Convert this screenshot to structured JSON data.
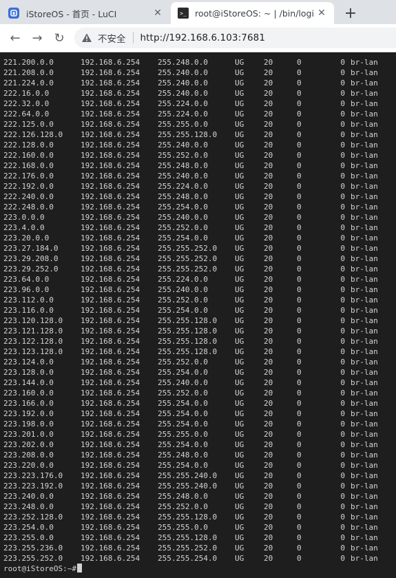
{
  "colors": {
    "tabbar_bg": "#dee1e6",
    "terminal_bg": "#1e1e1e",
    "terminal_fg": "#d4d4d4",
    "warning_icon": "#5f6368"
  },
  "tabs": [
    {
      "title": "iStoreOS - 首页 - LuCI",
      "icon": "istoreos-favicon-icon",
      "close": "✕",
      "active": false
    },
    {
      "title": "root@iStoreOS: ~ | /bin/login",
      "icon": "terminal-favicon-icon",
      "close": "✕",
      "active": true
    }
  ],
  "new_tab_label": "+",
  "toolbar": {
    "back_icon": "←",
    "forward_icon": "→",
    "reload_icon": "↻",
    "security_label": "不安全",
    "url": "http://192.168.6.103:7681"
  },
  "terminal": {
    "rows": [
      [
        "221.200.0.0",
        "192.168.6.254",
        "255.248.0.0",
        "UG",
        "20",
        "0",
        "0",
        "br-lan"
      ],
      [
        "221.208.0.0",
        "192.168.6.254",
        "255.240.0.0",
        "UG",
        "20",
        "0",
        "0",
        "br-lan"
      ],
      [
        "221.224.0.0",
        "192.168.6.254",
        "255.240.0.0",
        "UG",
        "20",
        "0",
        "0",
        "br-lan"
      ],
      [
        "222.16.0.0",
        "192.168.6.254",
        "255.240.0.0",
        "UG",
        "20",
        "0",
        "0",
        "br-lan"
      ],
      [
        "222.32.0.0",
        "192.168.6.254",
        "255.224.0.0",
        "UG",
        "20",
        "0",
        "0",
        "br-lan"
      ],
      [
        "222.64.0.0",
        "192.168.6.254",
        "255.224.0.0",
        "UG",
        "20",
        "0",
        "0",
        "br-lan"
      ],
      [
        "222.125.0.0",
        "192.168.6.254",
        "255.255.0.0",
        "UG",
        "20",
        "0",
        "0",
        "br-lan"
      ],
      [
        "222.126.128.0",
        "192.168.6.254",
        "255.255.128.0",
        "UG",
        "20",
        "0",
        "0",
        "br-lan"
      ],
      [
        "222.128.0.0",
        "192.168.6.254",
        "255.240.0.0",
        "UG",
        "20",
        "0",
        "0",
        "br-lan"
      ],
      [
        "222.160.0.0",
        "192.168.6.254",
        "255.252.0.0",
        "UG",
        "20",
        "0",
        "0",
        "br-lan"
      ],
      [
        "222.168.0.0",
        "192.168.6.254",
        "255.248.0.0",
        "UG",
        "20",
        "0",
        "0",
        "br-lan"
      ],
      [
        "222.176.0.0",
        "192.168.6.254",
        "255.240.0.0",
        "UG",
        "20",
        "0",
        "0",
        "br-lan"
      ],
      [
        "222.192.0.0",
        "192.168.6.254",
        "255.224.0.0",
        "UG",
        "20",
        "0",
        "0",
        "br-lan"
      ],
      [
        "222.240.0.0",
        "192.168.6.254",
        "255.248.0.0",
        "UG",
        "20",
        "0",
        "0",
        "br-lan"
      ],
      [
        "222.248.0.0",
        "192.168.6.254",
        "255.254.0.0",
        "UG",
        "20",
        "0",
        "0",
        "br-lan"
      ],
      [
        "223.0.0.0",
        "192.168.6.254",
        "255.240.0.0",
        "UG",
        "20",
        "0",
        "0",
        "br-lan"
      ],
      [
        "223.4.0.0",
        "192.168.6.254",
        "255.252.0.0",
        "UG",
        "20",
        "0",
        "0",
        "br-lan"
      ],
      [
        "223.20.0.0",
        "192.168.6.254",
        "255.254.0.0",
        "UG",
        "20",
        "0",
        "0",
        "br-lan"
      ],
      [
        "223.27.184.0",
        "192.168.6.254",
        "255.255.252.0",
        "UG",
        "20",
        "0",
        "0",
        "br-lan"
      ],
      [
        "223.29.208.0",
        "192.168.6.254",
        "255.255.252.0",
        "UG",
        "20",
        "0",
        "0",
        "br-lan"
      ],
      [
        "223.29.252.0",
        "192.168.6.254",
        "255.255.252.0",
        "UG",
        "20",
        "0",
        "0",
        "br-lan"
      ],
      [
        "223.64.0.0",
        "192.168.6.254",
        "255.224.0.0",
        "UG",
        "20",
        "0",
        "0",
        "br-lan"
      ],
      [
        "223.96.0.0",
        "192.168.6.254",
        "255.240.0.0",
        "UG",
        "20",
        "0",
        "0",
        "br-lan"
      ],
      [
        "223.112.0.0",
        "192.168.6.254",
        "255.252.0.0",
        "UG",
        "20",
        "0",
        "0",
        "br-lan"
      ],
      [
        "223.116.0.0",
        "192.168.6.254",
        "255.254.0.0",
        "UG",
        "20",
        "0",
        "0",
        "br-lan"
      ],
      [
        "223.120.128.0",
        "192.168.6.254",
        "255.255.128.0",
        "UG",
        "20",
        "0",
        "0",
        "br-lan"
      ],
      [
        "223.121.128.0",
        "192.168.6.254",
        "255.255.128.0",
        "UG",
        "20",
        "0",
        "0",
        "br-lan"
      ],
      [
        "223.122.128.0",
        "192.168.6.254",
        "255.255.128.0",
        "UG",
        "20",
        "0",
        "0",
        "br-lan"
      ],
      [
        "223.123.128.0",
        "192.168.6.254",
        "255.255.128.0",
        "UG",
        "20",
        "0",
        "0",
        "br-lan"
      ],
      [
        "223.124.0.0",
        "192.168.6.254",
        "255.252.0.0",
        "UG",
        "20",
        "0",
        "0",
        "br-lan"
      ],
      [
        "223.128.0.0",
        "192.168.6.254",
        "255.254.0.0",
        "UG",
        "20",
        "0",
        "0",
        "br-lan"
      ],
      [
        "223.144.0.0",
        "192.168.6.254",
        "255.240.0.0",
        "UG",
        "20",
        "0",
        "0",
        "br-lan"
      ],
      [
        "223.160.0.0",
        "192.168.6.254",
        "255.252.0.0",
        "UG",
        "20",
        "0",
        "0",
        "br-lan"
      ],
      [
        "223.166.0.0",
        "192.168.6.254",
        "255.254.0.0",
        "UG",
        "20",
        "0",
        "0",
        "br-lan"
      ],
      [
        "223.192.0.0",
        "192.168.6.254",
        "255.254.0.0",
        "UG",
        "20",
        "0",
        "0",
        "br-lan"
      ],
      [
        "223.198.0.0",
        "192.168.6.254",
        "255.254.0.0",
        "UG",
        "20",
        "0",
        "0",
        "br-lan"
      ],
      [
        "223.201.0.0",
        "192.168.6.254",
        "255.255.0.0",
        "UG",
        "20",
        "0",
        "0",
        "br-lan"
      ],
      [
        "223.202.0.0",
        "192.168.6.254",
        "255.254.0.0",
        "UG",
        "20",
        "0",
        "0",
        "br-lan"
      ],
      [
        "223.208.0.0",
        "192.168.6.254",
        "255.248.0.0",
        "UG",
        "20",
        "0",
        "0",
        "br-lan"
      ],
      [
        "223.220.0.0",
        "192.168.6.254",
        "255.254.0.0",
        "UG",
        "20",
        "0",
        "0",
        "br-lan"
      ],
      [
        "223.223.176.0",
        "192.168.6.254",
        "255.255.240.0",
        "UG",
        "20",
        "0",
        "0",
        "br-lan"
      ],
      [
        "223.223.192.0",
        "192.168.6.254",
        "255.255.240.0",
        "UG",
        "20",
        "0",
        "0",
        "br-lan"
      ],
      [
        "223.240.0.0",
        "192.168.6.254",
        "255.248.0.0",
        "UG",
        "20",
        "0",
        "0",
        "br-lan"
      ],
      [
        "223.248.0.0",
        "192.168.6.254",
        "255.252.0.0",
        "UG",
        "20",
        "0",
        "0",
        "br-lan"
      ],
      [
        "223.252.128.0",
        "192.168.6.254",
        "255.255.128.0",
        "UG",
        "20",
        "0",
        "0",
        "br-lan"
      ],
      [
        "223.254.0.0",
        "192.168.6.254",
        "255.255.0.0",
        "UG",
        "20",
        "0",
        "0",
        "br-lan"
      ],
      [
        "223.255.0.0",
        "192.168.6.254",
        "255.255.128.0",
        "UG",
        "20",
        "0",
        "0",
        "br-lan"
      ],
      [
        "223.255.236.0",
        "192.168.6.254",
        "255.255.252.0",
        "UG",
        "20",
        "0",
        "0",
        "br-lan"
      ],
      [
        "223.255.252.0",
        "192.168.6.254",
        "255.255.254.0",
        "UG",
        "20",
        "0",
        "0",
        "br-lan"
      ]
    ],
    "prompt": "root@iStoreOS:~#"
  }
}
